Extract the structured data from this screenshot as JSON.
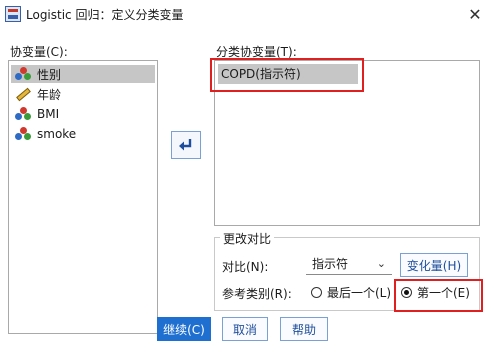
{
  "window": {
    "title": "Logistic 回归：定义分类变量",
    "close_glyph": "✕"
  },
  "covariates": {
    "label": "协变量(C):",
    "items": [
      {
        "name": "性别",
        "icon": "nominal-variable-icon"
      },
      {
        "name": "年龄",
        "icon": "scale-variable-icon"
      },
      {
        "name": "BMI",
        "icon": "nominal-variable-icon"
      },
      {
        "name": "smoke",
        "icon": "nominal-variable-icon"
      }
    ],
    "selected_index": 0
  },
  "move_button": {
    "icon": "move-left-arrow-icon"
  },
  "categorical_covariates": {
    "label": "分类协变量(T):",
    "items": [
      "COPD(指示符)"
    ]
  },
  "change_contrast": {
    "title": "更改对比",
    "contrast_label": "对比(N):",
    "contrast_value": "指示符",
    "chevron_glyph": "⌄",
    "change_button": "变化量(H)",
    "reference_label": "参考类别(R):",
    "reference_options": [
      {
        "label": "最后一个(L)",
        "checked": false
      },
      {
        "label": "第一个(E)",
        "checked": true
      }
    ]
  },
  "buttons": {
    "continue": "继续(C)",
    "cancel": "取消",
    "help": "帮助"
  },
  "colors": {
    "highlight": "#e02020",
    "primary_button": "#1f6fd1",
    "selection": "#c6c6c6"
  }
}
